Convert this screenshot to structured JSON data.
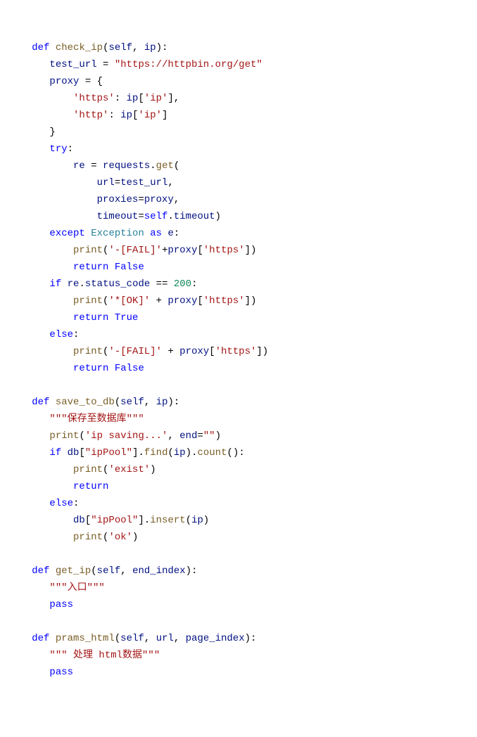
{
  "code": {
    "fn1": {
      "def": "def",
      "name": "check_ip",
      "self": "self",
      "p1": "ip"
    },
    "l2": {
      "var": "test_url",
      "eq": " = ",
      "str": "\"https://httpbin.org/get\""
    },
    "l3": {
      "var": "proxy",
      "eq": " = {"
    },
    "l4": {
      "k": "'https'",
      "c": ": ",
      "v": "ip",
      "b1": "[",
      "idx": "'ip'",
      "b2": "],"
    },
    "l5": {
      "k": "'http'",
      "c": ": ",
      "v": "ip",
      "b1": "[",
      "idx": "'ip'",
      "b2": "]"
    },
    "l6": {
      "brace": "}"
    },
    "l7": {
      "try": "try",
      "colon": ":"
    },
    "l8": {
      "var": "re",
      "eq": " = ",
      "obj": "requests",
      "dot": ".",
      "fn": "get",
      "p": "("
    },
    "l9": {
      "arg": "url",
      "eq": "=",
      "val": "test_url",
      "c": ","
    },
    "l10": {
      "arg": "proxies",
      "eq": "=",
      "val": "proxy",
      "c": ","
    },
    "l11": {
      "arg": "timeout",
      "eq": "=",
      "self": "self",
      "dot": ".",
      "prop": "timeout",
      "p": ")"
    },
    "l12": {
      "except": "except",
      "cls": "Exception",
      "as": "as",
      "e": "e",
      "colon": ":"
    },
    "l13": {
      "fn": "print",
      "p1": "(",
      "s": "'-[FAIL]'",
      "plus": "+",
      "v": "proxy",
      "b1": "[",
      "idx": "'https'",
      "b2": "])"
    },
    "l14": {
      "ret": "return",
      "val": "False"
    },
    "l15": {
      "if": "if",
      "obj": "re",
      "dot": ".",
      "prop": "status_code",
      "eq": " == ",
      "num": "200",
      "colon": ":"
    },
    "l16": {
      "fn": "print",
      "p1": "(",
      "s": "'*[OK]'",
      "plus": " + ",
      "v": "proxy",
      "b1": "[",
      "idx": "'https'",
      "b2": "])"
    },
    "l17": {
      "ret": "return",
      "val": "True"
    },
    "l18": {
      "else": "else",
      "colon": ":"
    },
    "l19": {
      "fn": "print",
      "p1": "(",
      "s": "'-[FAIL]'",
      "plus": " + ",
      "v": "proxy",
      "b1": "[",
      "idx": "'https'",
      "b2": "])"
    },
    "l20": {
      "ret": "return",
      "val": "False"
    },
    "fn2": {
      "def": "def",
      "name": "save_to_db",
      "self": "self",
      "p1": "ip"
    },
    "l22": {
      "doc": "\"\"\"保存至数据库\"\"\""
    },
    "l23": {
      "fn": "print",
      "p1": "(",
      "s": "'ip saving...'",
      "c": ", ",
      "arg": "end",
      "eq": "=",
      "s2": "\"\"",
      "p2": ")"
    },
    "l24": {
      "if": "if",
      "obj": "db",
      "b1": "[",
      "k": "\"ipPool\"",
      "b2": "].",
      "fn1": "find",
      "p1": "(",
      "arg": "ip",
      "p2": ").",
      "fn2": "count",
      "p3": "():"
    },
    "l25": {
      "fn": "print",
      "p1": "(",
      "s": "'exist'",
      "p2": ")"
    },
    "l26": {
      "ret": "return"
    },
    "l27": {
      "else": "else",
      "colon": ":"
    },
    "l28": {
      "obj": "db",
      "b1": "[",
      "k": "\"ipPool\"",
      "b2": "].",
      "fn": "insert",
      "p1": "(",
      "arg": "ip",
      "p2": ")"
    },
    "l29": {
      "fn": "print",
      "p1": "(",
      "s": "'ok'",
      "p2": ")"
    },
    "fn3": {
      "def": "def",
      "name": "get_ip",
      "self": "self",
      "p1": "end_index"
    },
    "l31": {
      "doc": "\"\"\"入口\"\"\""
    },
    "l32": {
      "pass": "pass"
    },
    "fn4": {
      "def": "def",
      "name": "prams_html",
      "self": "self",
      "p1": "url",
      "p2": "page_index"
    },
    "l34": {
      "doc": "\"\"\" 处理 html数据\"\"\""
    },
    "l35": {
      "pass": "pass"
    }
  }
}
